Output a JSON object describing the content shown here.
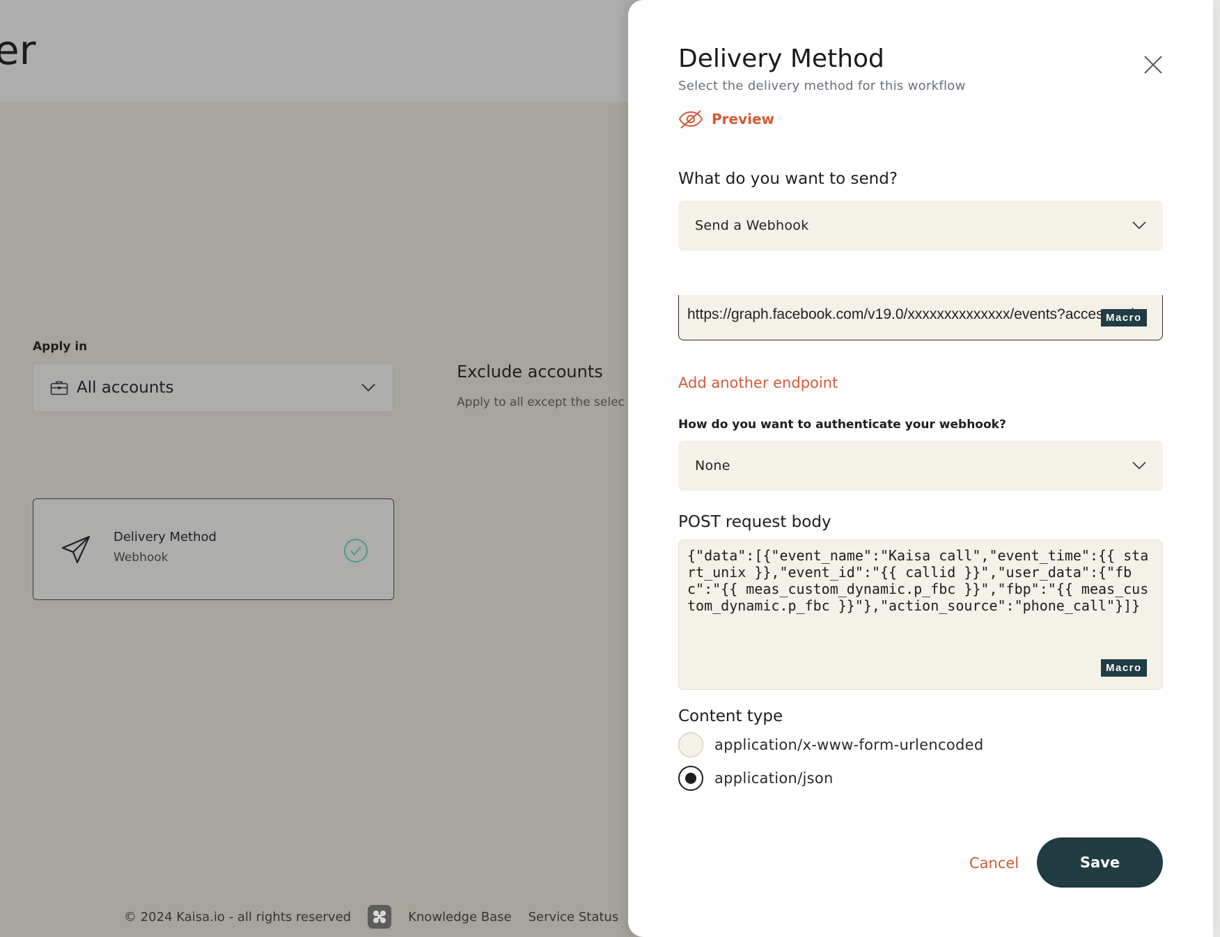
{
  "background": {
    "page_title_fragment": "er",
    "apply_in": {
      "label": "Apply in",
      "value": "All accounts"
    },
    "exclude": {
      "title": "Exclude accounts",
      "subtitle": "Apply to all except the selec"
    },
    "delivery_card": {
      "title": "Delivery Method",
      "subtitle": "Webhook"
    },
    "footer": {
      "copyright": "© 2024 Kaisa.io - all rights reserved",
      "knowledge_base": "Knowledge Base",
      "service_status": "Service Status"
    }
  },
  "drawer": {
    "title": "Delivery Method",
    "subtitle": "Select the delivery method for this workflow",
    "preview_label": "Preview",
    "send_question": "What do you want to send?",
    "send_select_value": "Send a Webhook",
    "endpoint_url": "https://graph.facebook.com/v19.0/xxxxxxxxxxxxxx/events?access_toke",
    "macro_label": "Macro",
    "add_endpoint_label": "Add another endpoint",
    "auth_question": "How do you want to authenticate your webhook?",
    "auth_select_value": "None",
    "post_body_label": "POST request body",
    "post_body": "{\"data\":[{\"event_name\":\"Kaisa call\",\"event_time\":{{ start_unix }},\"event_id\":\"{{ callid }}\",\"user_data\":{\"fbc\":\"{{ meas_custom_dynamic.p_fbc }}\",\"fbp\":\"{{ meas_custom_dynamic.p_fbc }}\"},\"action_source\":\"phone_call\"}]}",
    "content_type_label": "Content type",
    "content_types": [
      {
        "label": "application/x-www-form-urlencoded",
        "selected": false
      },
      {
        "label": "application/json",
        "selected": true
      }
    ],
    "cancel_label": "Cancel",
    "save_label": "Save"
  },
  "colors": {
    "accent": "#d25a35",
    "primary_dark": "#213c42",
    "field_bg": "#f4f1e8",
    "check_teal": "#4a9c8a"
  }
}
